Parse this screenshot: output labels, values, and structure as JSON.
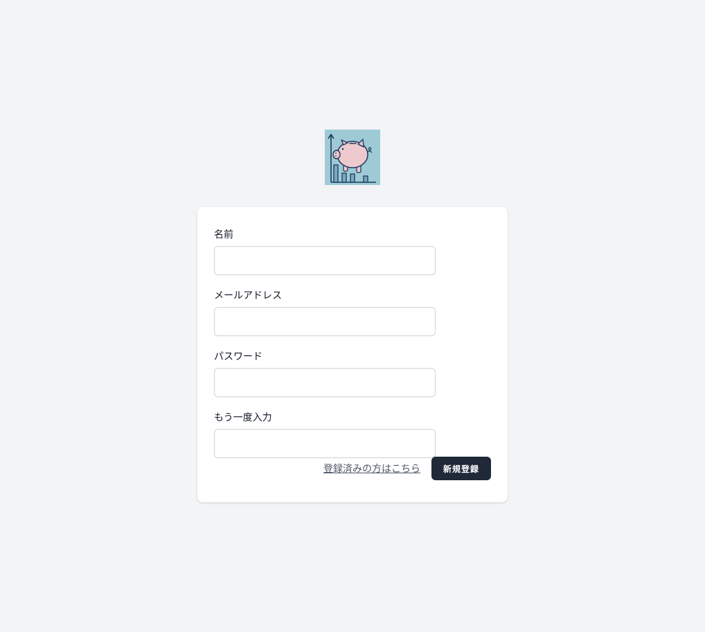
{
  "logo": {
    "icon": "piggy-bank-chart-icon",
    "bg_color": "#9ecad6"
  },
  "form": {
    "fields": [
      {
        "label": "名前",
        "value": "",
        "type": "text"
      },
      {
        "label": "メールアドレス",
        "value": "",
        "type": "email"
      },
      {
        "label": "パスワード",
        "value": "",
        "type": "password"
      },
      {
        "label": "もう一度入力",
        "value": "",
        "type": "password"
      }
    ],
    "login_link": "登録済みの方はこちら",
    "submit_label": "新規登録"
  },
  "colors": {
    "background": "#f3f4f6",
    "button": "#1f2937"
  }
}
